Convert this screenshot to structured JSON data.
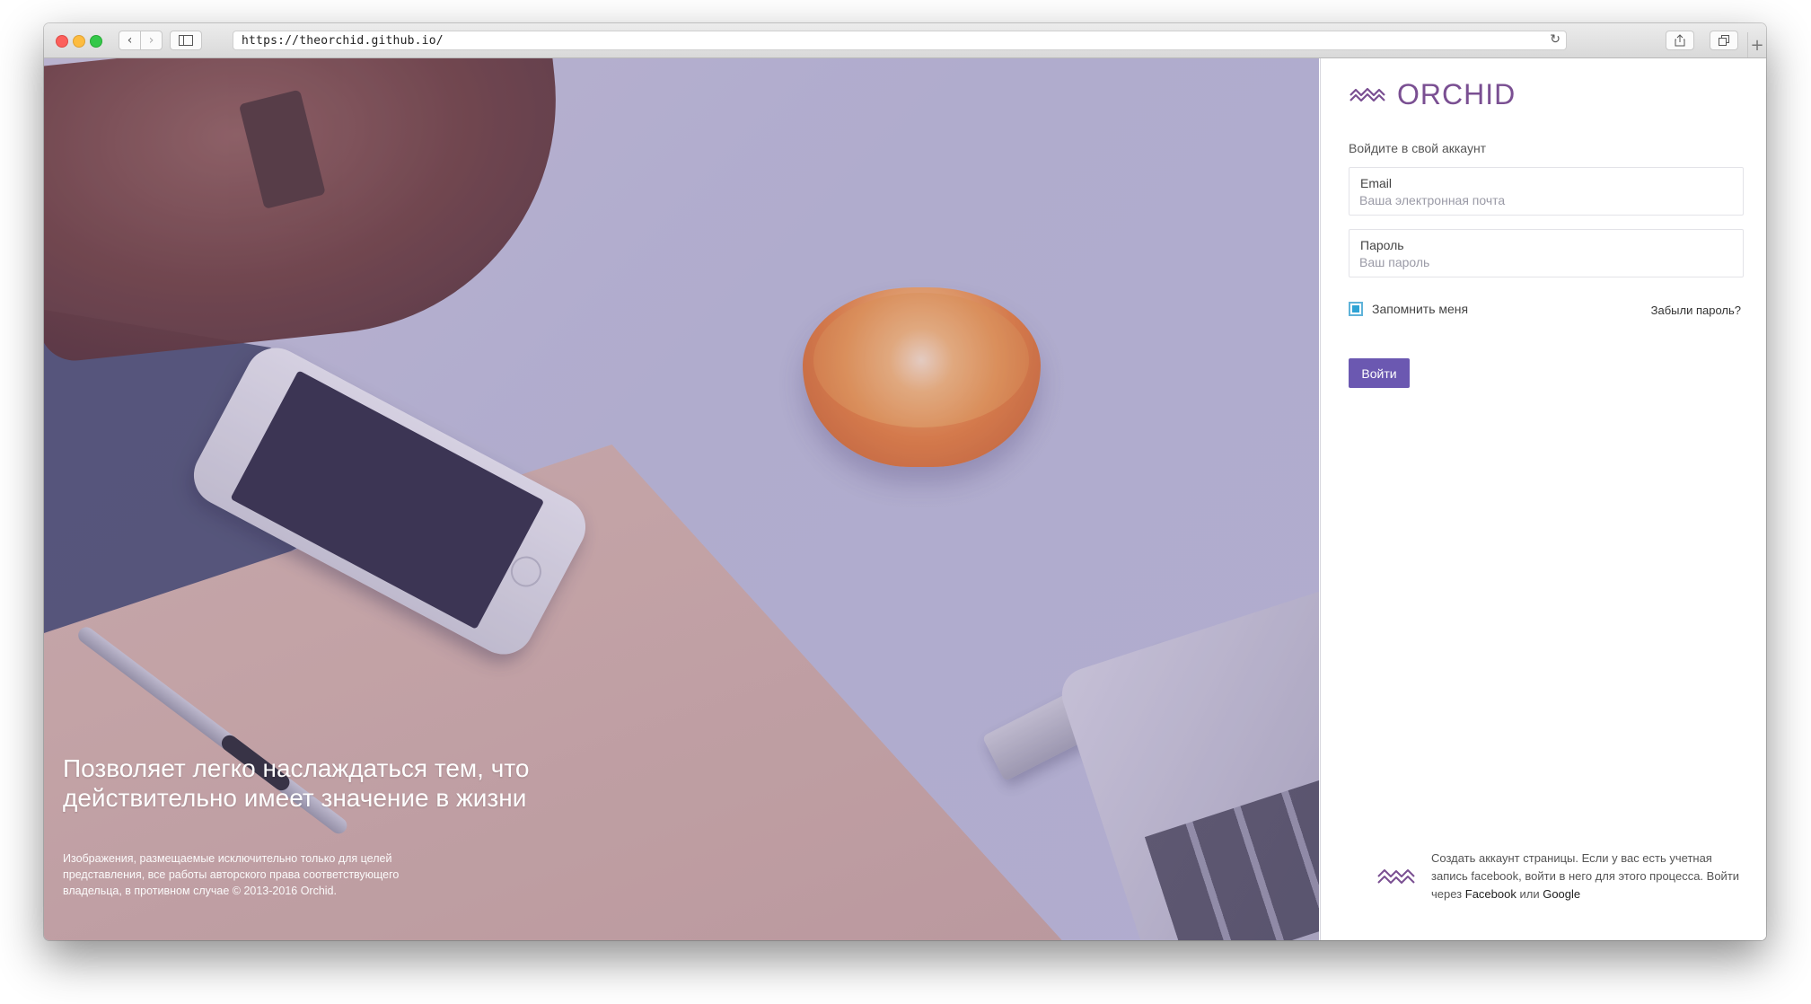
{
  "browser": {
    "url": "https://theorchid.github.io/"
  },
  "hero": {
    "headline": "Позволяет легко наслаждаться тем, что действительно имеет значение в жизни",
    "caption": "Изображения, размещаемые исключительно только для целей представления, все работы авторского права соответствующего владельца, в противном случае © 2013-2016 Orchid."
  },
  "login": {
    "logo_text": "ORCHID",
    "subtitle": "Войдите в свой аккаунт",
    "email_label": "Email",
    "email_placeholder": "Ваша электронная почта",
    "password_label": "Пароль",
    "password_placeholder": "Ваш пароль",
    "remember_label": "Запомнить меня",
    "remember_checked": true,
    "forgot_link": "Забыли пароль?",
    "submit_label": "Войти"
  },
  "footer": {
    "text_before": "Создать аккаунт страницы. Если у вас есть учетная запись facebook, войти в него для этого процесса. Войти через",
    "facebook_link": "Facebook",
    "or_text": "или",
    "google_link": "Google"
  },
  "colors": {
    "brand": "#7a4f92",
    "button": "#6b58b1",
    "checkbox": "#2ea3d5"
  },
  "icons": [
    "back-icon",
    "forward-icon",
    "sidebar-icon",
    "reload-icon",
    "share-icon",
    "tabs-icon",
    "new-tab-icon",
    "orchid-logo-icon"
  ]
}
